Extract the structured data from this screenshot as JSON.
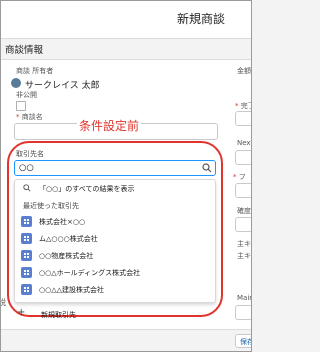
{
  "header": {
    "title": "新規商談"
  },
  "section": {
    "title": "商談情報"
  },
  "fields": {
    "owner_label": "商談 所有者",
    "owner_value": "サークレイス 太郎",
    "private_label": "非公開",
    "opp_name_label": "商談名",
    "account_label": "取引先名"
  },
  "right_column": {
    "amount_label": "金額",
    "close_label": "完了",
    "next_label": "Next",
    "phase_label": "フ",
    "probability_label": "確度",
    "forecast_label": "主キ",
    "forecast2_label": "主キ",
    "main_label": "Main"
  },
  "annotation": {
    "text": "条件設定前"
  },
  "search": {
    "value": "○○"
  },
  "dropdown": {
    "show_all": "「○○」のすべての結果を表示",
    "recent_header": "最近使った取引先",
    "items": [
      "株式会社×○○",
      "ム△○○○株式会社",
      "○○物産株式会社",
      "○○△ホールディングス株式会社",
      "○○△△建設株式会社"
    ],
    "new_account": "新規取引先"
  },
  "footer": {
    "save_new": "保存 & 新"
  },
  "colors": {
    "annotation": "#e0342d",
    "focus": "#1b96ff",
    "record_icon": "#5a7fd1"
  }
}
